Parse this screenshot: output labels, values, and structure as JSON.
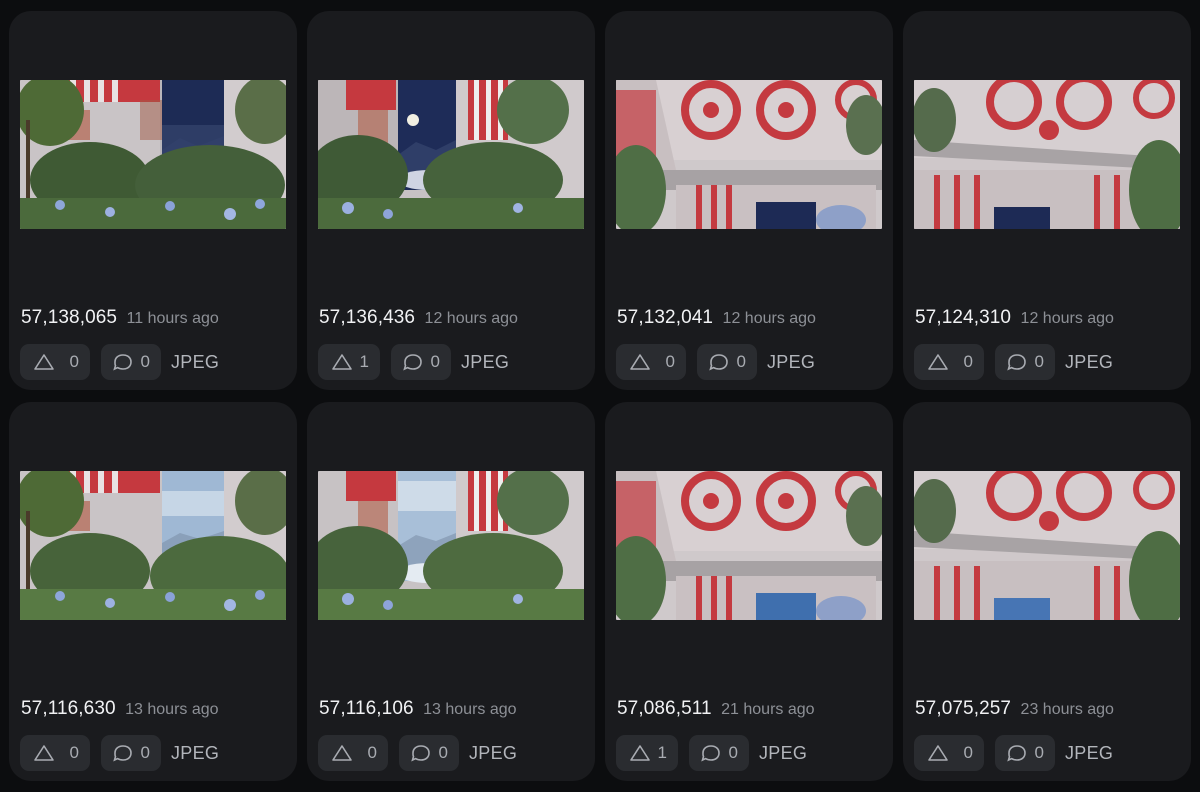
{
  "colors": {
    "page_bg": "#0c0d0f",
    "card_bg": "#1a1b1e",
    "pill_bg": "#2a2c30",
    "muted_text": "#8d9096",
    "primary_text": "#f1f2f4"
  },
  "cards": [
    {
      "id": "57,138,065",
      "time": "11 hours ago",
      "upvotes": "0",
      "comments": "0",
      "format": "JPEG",
      "scene": "garden-night",
      "icon_up": "upvote-triangle-icon",
      "icon_comment": "comment-bubble-icon"
    },
    {
      "id": "57,136,436",
      "time": "12 hours ago",
      "upvotes": "1",
      "comments": "0",
      "format": "JPEG",
      "scene": "garden-moon",
      "icon_up": "upvote-triangle-icon",
      "icon_comment": "comment-bubble-icon"
    },
    {
      "id": "57,132,041",
      "time": "12 hours ago",
      "upvotes": "0",
      "comments": "0",
      "format": "JPEG",
      "scene": "ceiling-night",
      "icon_up": "upvote-triangle-icon",
      "icon_comment": "comment-bubble-icon"
    },
    {
      "id": "57,124,310",
      "time": "12 hours ago",
      "upvotes": "0",
      "comments": "0",
      "format": "JPEG",
      "scene": "ceiling-night-2",
      "icon_up": "upvote-triangle-icon",
      "icon_comment": "comment-bubble-icon"
    },
    {
      "id": "57,116,630",
      "time": "13 hours ago",
      "upvotes": "0",
      "comments": "0",
      "format": "JPEG",
      "scene": "garden-day",
      "icon_up": "upvote-triangle-icon",
      "icon_comment": "comment-bubble-icon"
    },
    {
      "id": "57,116,106",
      "time": "13 hours ago",
      "upvotes": "0",
      "comments": "0",
      "format": "JPEG",
      "scene": "garden-day-2",
      "icon_up": "upvote-triangle-icon",
      "icon_comment": "comment-bubble-icon"
    },
    {
      "id": "57,086,511",
      "time": "21 hours ago",
      "upvotes": "1",
      "comments": "0",
      "format": "JPEG",
      "scene": "ceiling-day",
      "icon_up": "upvote-triangle-icon",
      "icon_comment": "comment-bubble-icon"
    },
    {
      "id": "57,075,257",
      "time": "23 hours ago",
      "upvotes": "0",
      "comments": "0",
      "format": "JPEG",
      "scene": "ceiling-day-2",
      "icon_up": "upvote-triangle-icon",
      "icon_comment": "comment-bubble-icon"
    }
  ]
}
